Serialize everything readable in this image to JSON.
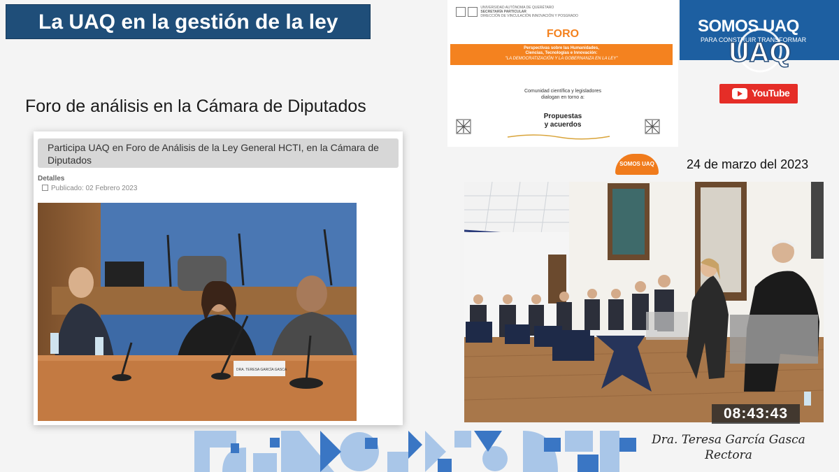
{
  "slide": {
    "title": "La UAQ en la gestión de la ley",
    "subtitle": "Foro de análisis en la Cámara de Diputados"
  },
  "article": {
    "headline": "Participa UAQ en Foro de Análisis de la Ley General HCTI, en la Cámara de Diputados",
    "details_label": "Detalles",
    "published": "Publicado: 02 Febrero 2023",
    "nameplate_text": "DRA. TERESA GARCÍA GASCA"
  },
  "poster": {
    "foro": "FORO",
    "band_line1": "Perspectivas sobre las Humanidades,",
    "band_line2": "Ciencias, Tecnologías e Innovación:",
    "band_quote": "\"LA DEMOCRATIZACIÓN Y LA GOBERNANZA EN LA LEY\"",
    "community_line1": "Comunidad científica y legisladores",
    "community_line2": "dialogan en torno a:",
    "proposals_line1": "Propuestas",
    "proposals_line2": "y acuerdos",
    "logo_line1": "UNIVERSIDAD AUTÓNOMA DE QUERÉTARO",
    "logo_line2": "SECRETARÍA PARTICULAR",
    "logo_line3": "DIRECCIÓN DE VINCULACIÓN INNOVACIÓN Y POSGRADO"
  },
  "brand": {
    "somos": "SOMOS UAQ",
    "tagline": "PARA CONSTRUIR TRANSFORMAR",
    "uaq": "UAQ",
    "youtube": "YouTube",
    "pill": "SOMOS UAQ"
  },
  "event": {
    "date": "24 de marzo del 2023",
    "timestamp": "08:43:43"
  },
  "signature": {
    "name": "Dra. Teresa García Gasca",
    "role": "Rectora"
  },
  "colors": {
    "title_blue": "#1f4e79",
    "uaq_blue": "#1d5fa1",
    "orange": "#f4821f",
    "youtube_red": "#e52d27"
  }
}
